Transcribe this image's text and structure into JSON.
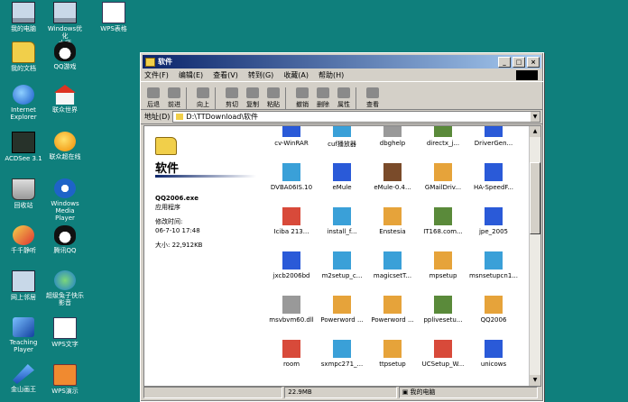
{
  "desktop_icons": [
    {
      "label": "我的电脑",
      "icon": "my-computer-icon"
    },
    {
      "label": "Windows优化\n大师",
      "icon": "optimizer-icon"
    },
    {
      "label": "WPS表格",
      "icon": "wps-spreadsheet-icon"
    },
    {
      "label": "我的文档",
      "icon": "my-documents-icon"
    },
    {
      "label": "QQ游戏",
      "icon": "qq-game-icon"
    },
    {
      "label": "Internet\nExplorer",
      "icon": "ie-icon"
    },
    {
      "label": "联众世界",
      "icon": "ourgame-icon"
    },
    {
      "label": "ACDSee 3.1",
      "icon": "acdsee-icon"
    },
    {
      "label": "联众超在线",
      "icon": "ourgame-online-icon"
    },
    {
      "label": "回收站",
      "icon": "recycle-bin-icon"
    },
    {
      "label": "Windows\nMedia Player",
      "icon": "media-player-icon"
    },
    {
      "label": "千千静听",
      "icon": "ttplayer-icon"
    },
    {
      "label": "腾讯QQ",
      "icon": "qq-icon"
    },
    {
      "label": "网上邻居",
      "icon": "network-icon"
    },
    {
      "label": "超级兔子快乐\n影音",
      "icon": "rabbit-media-icon"
    },
    {
      "label": "Teaching\nPlayer",
      "icon": "teaching-player-icon"
    },
    {
      "label": "WPS文字",
      "icon": "wps-writer-icon"
    },
    {
      "label": "金山画王",
      "icon": "paint-icon"
    },
    {
      "label": "WPS演示",
      "icon": "wps-present-icon"
    }
  ],
  "window": {
    "title": "软件",
    "menu": [
      "文件(F)",
      "编辑(E)",
      "查看(V)",
      "转到(G)",
      "收藏(A)",
      "帮助(H)"
    ],
    "toolbar": [
      "后退",
      "前进",
      "向上",
      "剪切",
      "复制",
      "粘贴",
      "撤销",
      "删除",
      "属性",
      "查看"
    ],
    "address_label": "地址(D)",
    "address": "D:\\TTDownload\\软件",
    "left_title": "软件",
    "selected_name": "QQ2006.exe",
    "selected_type": "应用程序",
    "modified_label": "修改时间:",
    "modified_value": "06-7-10 17:48",
    "size_label": "大小:",
    "size_value": "22,912KB",
    "files": [
      {
        "name": "cv-WinRAR",
        "icon": "rar-icon",
        "c": "c1"
      },
      {
        "name": "cuf播放器",
        "icon": "player-icon",
        "c": "c5"
      },
      {
        "name": "dbghelp",
        "icon": "dll-icon",
        "c": "c7"
      },
      {
        "name": "directx_j...",
        "icon": "setup-icon",
        "c": "c4"
      },
      {
        "name": "DriverGen...",
        "icon": "rar-icon",
        "c": "c1"
      },
      {
        "name": "DVBA06IS.10",
        "icon": "setup-icon",
        "c": "c5"
      },
      {
        "name": "eMule",
        "icon": "rar-icon",
        "c": "c1"
      },
      {
        "name": "eMule-0.4...",
        "icon": "box-icon",
        "c": "c3"
      },
      {
        "name": "GMailDriv...",
        "icon": "installer-icon",
        "c": "c2"
      },
      {
        "name": "HA-SpeedF...",
        "icon": "rar-icon",
        "c": "c1"
      },
      {
        "name": "Iciba 213...",
        "icon": "iciba-icon",
        "c": "c6"
      },
      {
        "name": "install_f...",
        "icon": "installer-icon",
        "c": "c5"
      },
      {
        "name": "Enstesia",
        "icon": "setup-icon",
        "c": "c2"
      },
      {
        "name": "IT168.com...",
        "icon": "setup-icon",
        "c": "c4"
      },
      {
        "name": "jpe_2005",
        "icon": "rar-icon",
        "c": "c1"
      },
      {
        "name": "jxcb2006bd",
        "icon": "rar-icon",
        "c": "c1"
      },
      {
        "name": "m2setup_c...",
        "icon": "installer-icon",
        "c": "c5"
      },
      {
        "name": "magicsetT...",
        "icon": "installer-icon",
        "c": "c5"
      },
      {
        "name": "mpsetup",
        "icon": "setup-icon",
        "c": "c2"
      },
      {
        "name": "msnsetupcn1...",
        "icon": "msn-icon",
        "c": "c5"
      },
      {
        "name": "msvbvm60.dll",
        "icon": "dll-icon",
        "c": "c7"
      },
      {
        "name": "Powerword ...",
        "icon": "setup-icon",
        "c": "c2"
      },
      {
        "name": "Powerword ...",
        "icon": "setup-icon",
        "c": "c2"
      },
      {
        "name": "pplivesetu...",
        "icon": "pplive-icon",
        "c": "c4"
      },
      {
        "name": "QQ2006",
        "icon": "qq-icon",
        "c": "c2"
      },
      {
        "name": "room",
        "icon": "room-icon",
        "c": "c6"
      },
      {
        "name": "sxmpc271_...",
        "icon": "installer-icon",
        "c": "c5"
      },
      {
        "name": "ttpsetup",
        "icon": "setup-icon",
        "c": "c2"
      },
      {
        "name": "UCSetup_W...",
        "icon": "setup-icon",
        "c": "c6"
      },
      {
        "name": "unicows",
        "icon": "rar-icon",
        "c": "c1"
      }
    ],
    "status_size": "22.9MB",
    "status_location": "我的电脑"
  }
}
